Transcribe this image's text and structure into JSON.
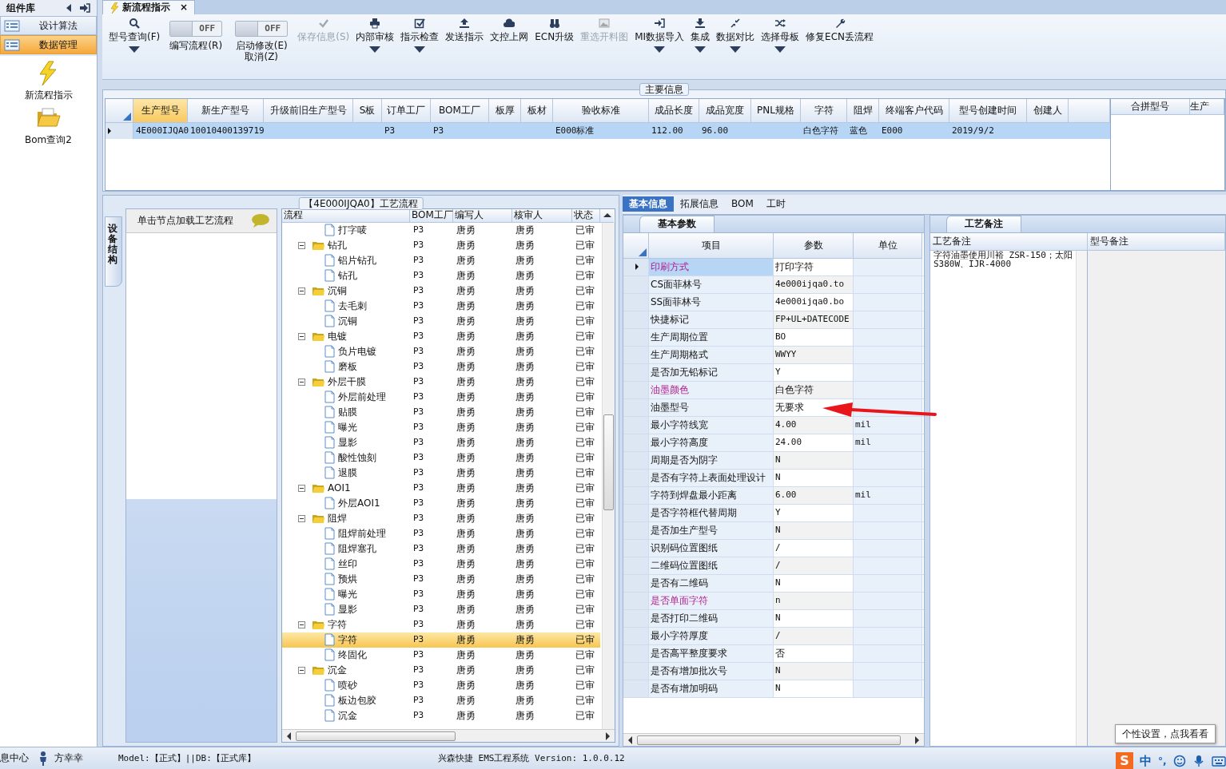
{
  "sidebar": {
    "title": "组件库",
    "nav": [
      {
        "label": "设计算法",
        "selected": false
      },
      {
        "label": "数据管理",
        "selected": true
      }
    ],
    "items": [
      {
        "label": "新流程指示"
      },
      {
        "label": "Bom查询2"
      }
    ]
  },
  "tabs": [
    {
      "label": "新流程指示",
      "close": "×",
      "selected": true
    }
  ],
  "toolbar": [
    {
      "kind": "button",
      "label": "型号查询(F)",
      "dropdown": true,
      "disabled": false
    },
    {
      "kind": "toggle",
      "switch_text": "OFF",
      "on": false,
      "label": "编写流程(R)"
    },
    {
      "kind": "toggle",
      "switch_text": "OFF",
      "on": false,
      "label": "启动修改(E)",
      "label_2": "取消(Z)"
    },
    {
      "kind": "button",
      "label": "保存信息(S)",
      "dropdown": false,
      "disabled": true
    },
    {
      "kind": "button",
      "label": "内部审核",
      "dropdown": true,
      "disabled": false
    },
    {
      "kind": "button",
      "label": "指示检查",
      "dropdown": true,
      "disabled": false
    },
    {
      "kind": "button",
      "label": "发送指示",
      "dropdown": false,
      "disabled": false
    },
    {
      "kind": "button",
      "label": "文控上网",
      "dropdown": false,
      "disabled": false
    },
    {
      "kind": "button",
      "label": "ECN升级",
      "dropdown": false,
      "disabled": false
    },
    {
      "kind": "button",
      "label": "重选开料图",
      "dropdown": false,
      "disabled": true
    },
    {
      "kind": "button",
      "label": "MI数据导入",
      "dropdown": true,
      "disabled": false
    },
    {
      "kind": "button",
      "label": "集成",
      "dropdown": true,
      "disabled": false
    },
    {
      "kind": "button",
      "label": "数据对比",
      "dropdown": true,
      "disabled": false
    },
    {
      "kind": "button",
      "label": "选择母板",
      "dropdown": true,
      "disabled": false
    },
    {
      "kind": "button",
      "label": "修复ECN丢流程",
      "dropdown": false,
      "disabled": false
    }
  ],
  "main_info": {
    "title": "主要信息",
    "columns": [
      {
        "label": "生产型号",
        "selected": true
      },
      {
        "label": "新生产型号",
        "selected": false
      },
      {
        "label": "升级前旧生产型号",
        "selected": false
      },
      {
        "label": "S板",
        "selected": false
      },
      {
        "label": "订单工厂",
        "selected": false
      },
      {
        "label": "BOM工厂",
        "selected": false
      },
      {
        "label": "板厚",
        "selected": false
      },
      {
        "label": "板材",
        "selected": false
      },
      {
        "label": "验收标准",
        "selected": false
      },
      {
        "label": "成品长度",
        "selected": false
      },
      {
        "label": "成品宽度",
        "selected": false
      },
      {
        "label": "PNL规格",
        "selected": false
      },
      {
        "label": "字符",
        "selected": false
      },
      {
        "label": "阻焊",
        "selected": false
      },
      {
        "label": "终端客户代码",
        "selected": false
      },
      {
        "label": "型号创建时间",
        "selected": false
      },
      {
        "label": "创建人",
        "selected": false
      }
    ],
    "rows": [
      {
        "selected": true,
        "cells": [
          "4E000IJQA0",
          "10010400139719",
          null,
          null,
          "P3",
          "P3",
          null,
          null,
          "E000标准",
          "112.00",
          "96.00",
          null,
          "白色字符",
          "蓝色",
          "E000",
          "2019/9/2",
          null
        ]
      }
    ],
    "side_columns": [
      "合拼型号",
      "生产"
    ]
  },
  "flow": {
    "title": "【4E000IJQA0】工艺流程",
    "side_tab": "设备结构",
    "hint": "单击节点加载工艺流程",
    "columns": [
      "流程",
      "BOM工厂",
      "编写人",
      "核审人",
      "状态"
    ],
    "nodes": [
      {
        "children": [
          {
            "label": "打字唛",
            "cells": [
              "P3",
              "唐勇",
              "唐勇",
              "已审"
            ],
            "selected": false
          }
        ]
      },
      {
        "label": "钻孔",
        "expanded": true,
        "selected": false,
        "cells": [
          "P3",
          "唐勇",
          "唐勇",
          "已审"
        ],
        "children": [
          {
            "label": "铝片钻孔",
            "cells": [
              "P3",
              "唐勇",
              "唐勇",
              "已审"
            ],
            "selected": false
          },
          {
            "label": "钻孔",
            "cells": [
              "P3",
              "唐勇",
              "唐勇",
              "已审"
            ],
            "selected": false
          }
        ]
      },
      {
        "label": "沉铜",
        "expanded": true,
        "selected": false,
        "cells": [
          "P3",
          "唐勇",
          "唐勇",
          "已审"
        ],
        "children": [
          {
            "label": "去毛刺",
            "cells": [
              "P3",
              "唐勇",
              "唐勇",
              "已审"
            ],
            "selected": false
          },
          {
            "label": "沉铜",
            "cells": [
              "P3",
              "唐勇",
              "唐勇",
              "已审"
            ],
            "selected": false
          }
        ]
      },
      {
        "label": "电镀",
        "expanded": true,
        "selected": false,
        "cells": [
          "P3",
          "唐勇",
          "唐勇",
          "已审"
        ],
        "children": [
          {
            "label": "负片电镀",
            "cells": [
              "P3",
              "唐勇",
              "唐勇",
              "已审"
            ],
            "selected": false
          },
          {
            "label": "磨板",
            "cells": [
              "P3",
              "唐勇",
              "唐勇",
              "已审"
            ],
            "selected": false
          }
        ]
      },
      {
        "label": "外层干膜",
        "expanded": true,
        "selected": false,
        "cells": [
          "P3",
          "唐勇",
          "唐勇",
          "已审"
        ],
        "children": [
          {
            "label": "外层前处理",
            "cells": [
              "P3",
              "唐勇",
              "唐勇",
              "已审"
            ],
            "selected": false
          },
          {
            "label": "贴膜",
            "cells": [
              "P3",
              "唐勇",
              "唐勇",
              "已审"
            ],
            "selected": false
          },
          {
            "label": "曝光",
            "cells": [
              "P3",
              "唐勇",
              "唐勇",
              "已审"
            ],
            "selected": false
          },
          {
            "label": "显影",
            "cells": [
              "P3",
              "唐勇",
              "唐勇",
              "已审"
            ],
            "selected": false
          },
          {
            "label": "酸性蚀刻",
            "cells": [
              "P3",
              "唐勇",
              "唐勇",
              "已审"
            ],
            "selected": false
          },
          {
            "label": "退膜",
            "cells": [
              "P3",
              "唐勇",
              "唐勇",
              "已审"
            ],
            "selected": false
          }
        ]
      },
      {
        "label": "AOI1",
        "expanded": true,
        "selected": false,
        "cells": [
          "P3",
          "唐勇",
          "唐勇",
          "已审"
        ],
        "children": [
          {
            "label": "外层AOI1",
            "cells": [
              "P3",
              "唐勇",
              "唐勇",
              "已审"
            ],
            "selected": false
          }
        ]
      },
      {
        "label": "阻焊",
        "expanded": true,
        "selected": false,
        "cells": [
          "P3",
          "唐勇",
          "唐勇",
          "已审"
        ],
        "children": [
          {
            "label": "阻焊前处理",
            "cells": [
              "P3",
              "唐勇",
              "唐勇",
              "已审"
            ],
            "selected": false
          },
          {
            "label": "阻焊塞孔",
            "cells": [
              "P3",
              "唐勇",
              "唐勇",
              "已审"
            ],
            "selected": false
          },
          {
            "label": "丝印",
            "cells": [
              "P3",
              "唐勇",
              "唐勇",
              "已审"
            ],
            "selected": false
          },
          {
            "label": "预烘",
            "cells": [
              "P3",
              "唐勇",
              "唐勇",
              "已审"
            ],
            "selected": false
          },
          {
            "label": "曝光",
            "cells": [
              "P3",
              "唐勇",
              "唐勇",
              "已审"
            ],
            "selected": false
          },
          {
            "label": "显影",
            "cells": [
              "P3",
              "唐勇",
              "唐勇",
              "已审"
            ],
            "selected": false
          }
        ]
      },
      {
        "label": "字符",
        "expanded": true,
        "selected": false,
        "cells": [
          "P3",
          "唐勇",
          "唐勇",
          "已审"
        ],
        "children": [
          {
            "label": "字符",
            "cells": [
              "P3",
              "唐勇",
              "唐勇",
              "已审"
            ],
            "selected": true
          },
          {
            "label": "终固化",
            "cells": [
              "P3",
              "唐勇",
              "唐勇",
              "已审"
            ],
            "selected": false
          }
        ]
      },
      {
        "label": "沉金",
        "expanded": true,
        "selected": false,
        "cells": [
          "P3",
          "唐勇",
          "唐勇",
          "已审"
        ],
        "children": [
          {
            "label": "喷砂",
            "cells": [
              "P3",
              "唐勇",
              "唐勇",
              "已审"
            ],
            "selected": false
          },
          {
            "label": "板边包胶",
            "cells": [
              "P3",
              "唐勇",
              "唐勇",
              "已审"
            ],
            "selected": false
          },
          {
            "label": "沉金",
            "cells": [
              "P3",
              "唐勇",
              "唐勇",
              "已审"
            ],
            "selected": false
          }
        ]
      }
    ]
  },
  "detail": {
    "tabs": [
      {
        "label": "基本信息",
        "selected": true
      },
      {
        "label": "拓展信息",
        "selected": false
      },
      {
        "label": "BOM",
        "selected": false
      },
      {
        "label": "工时",
        "selected": false
      }
    ],
    "params": {
      "title": "基本参数",
      "columns": [
        "项目",
        "参数",
        "单位"
      ],
      "rows": [
        {
          "item": "印刷方式",
          "value": "打印字符",
          "highlight": true,
          "selected": true
        },
        {
          "item": "CS面菲林号",
          "value": "4e000ijqa0.to",
          "highlight": false,
          "selected": false
        },
        {
          "item": "SS面菲林号",
          "value": "4e000ijqa0.bo",
          "highlight": false,
          "selected": false
        },
        {
          "item": "快捷标记",
          "value": "FP+UL+DATECODE",
          "highlight": false,
          "selected": false
        },
        {
          "item": "生产周期位置",
          "value": "BO",
          "highlight": false,
          "selected": false
        },
        {
          "item": "生产周期格式",
          "value": "WWYY",
          "highlight": false,
          "selected": false
        },
        {
          "item": "是否加无铅标记",
          "value": "Y",
          "highlight": false,
          "selected": false
        },
        {
          "item": "油墨颜色",
          "value": "白色字符",
          "highlight": true,
          "selected": false
        },
        {
          "item": "油墨型号",
          "value": "无要求",
          "highlight": false,
          "selected": false
        },
        {
          "item": "最小字符线宽",
          "value": "4.00",
          "unit": "mil",
          "highlight": false,
          "selected": false
        },
        {
          "item": "最小字符高度",
          "value": "24.00",
          "unit": "mil",
          "highlight": false,
          "selected": false
        },
        {
          "item": "周期是否为阴字",
          "value": "N",
          "highlight": false,
          "selected": false
        },
        {
          "item": "是否有字符上表面处理设计",
          "value": "N",
          "highlight": false,
          "selected": false
        },
        {
          "item": "字符到焊盘最小距离",
          "value": "6.00",
          "unit": "mil",
          "highlight": false,
          "selected": false
        },
        {
          "item": "是否字符框代替周期",
          "value": "Y",
          "highlight": false,
          "selected": false
        },
        {
          "item": "是否加生产型号",
          "value": "N",
          "highlight": false,
          "selected": false
        },
        {
          "item": "识别码位置图纸",
          "value": "/",
          "highlight": false,
          "selected": false
        },
        {
          "item": "二维码位置图纸",
          "value": "/",
          "highlight": false,
          "selected": false
        },
        {
          "item": "是否有二维码",
          "value": "N",
          "highlight": false,
          "selected": false
        },
        {
          "item": "是否单面字符",
          "value": "n",
          "highlight": true,
          "selected": false
        },
        {
          "item": "是否打印二维码",
          "value": "N",
          "highlight": false,
          "selected": false
        },
        {
          "item": "最小字符厚度",
          "value": "/",
          "highlight": false,
          "selected": false
        },
        {
          "item": "是否高平整度要求",
          "value": "否",
          "highlight": false,
          "selected": false
        },
        {
          "item": "是否有增加批次号",
          "value": "N",
          "highlight": false,
          "selected": false
        },
        {
          "item": "是否有增加明码",
          "value": "N",
          "highlight": false,
          "selected": false
        }
      ]
    },
    "notes": {
      "title": "工艺备注",
      "columns": [
        "工艺备注",
        "型号备注"
      ],
      "text": "字符油墨使用川裕 ZSR-150；太阳S380W、IJR-4000"
    }
  },
  "status_bar": {
    "message_center": "息中心",
    "user": "方幸幸",
    "env": "Model:【正式】||DB:【正式库】",
    "version": "兴森快捷 EMS工程系统 Version: 1.0.0.12"
  },
  "tooltip": "个性设置，点我看看",
  "ime": {
    "logo": "S",
    "mode": "中",
    "punct": "°,"
  }
}
